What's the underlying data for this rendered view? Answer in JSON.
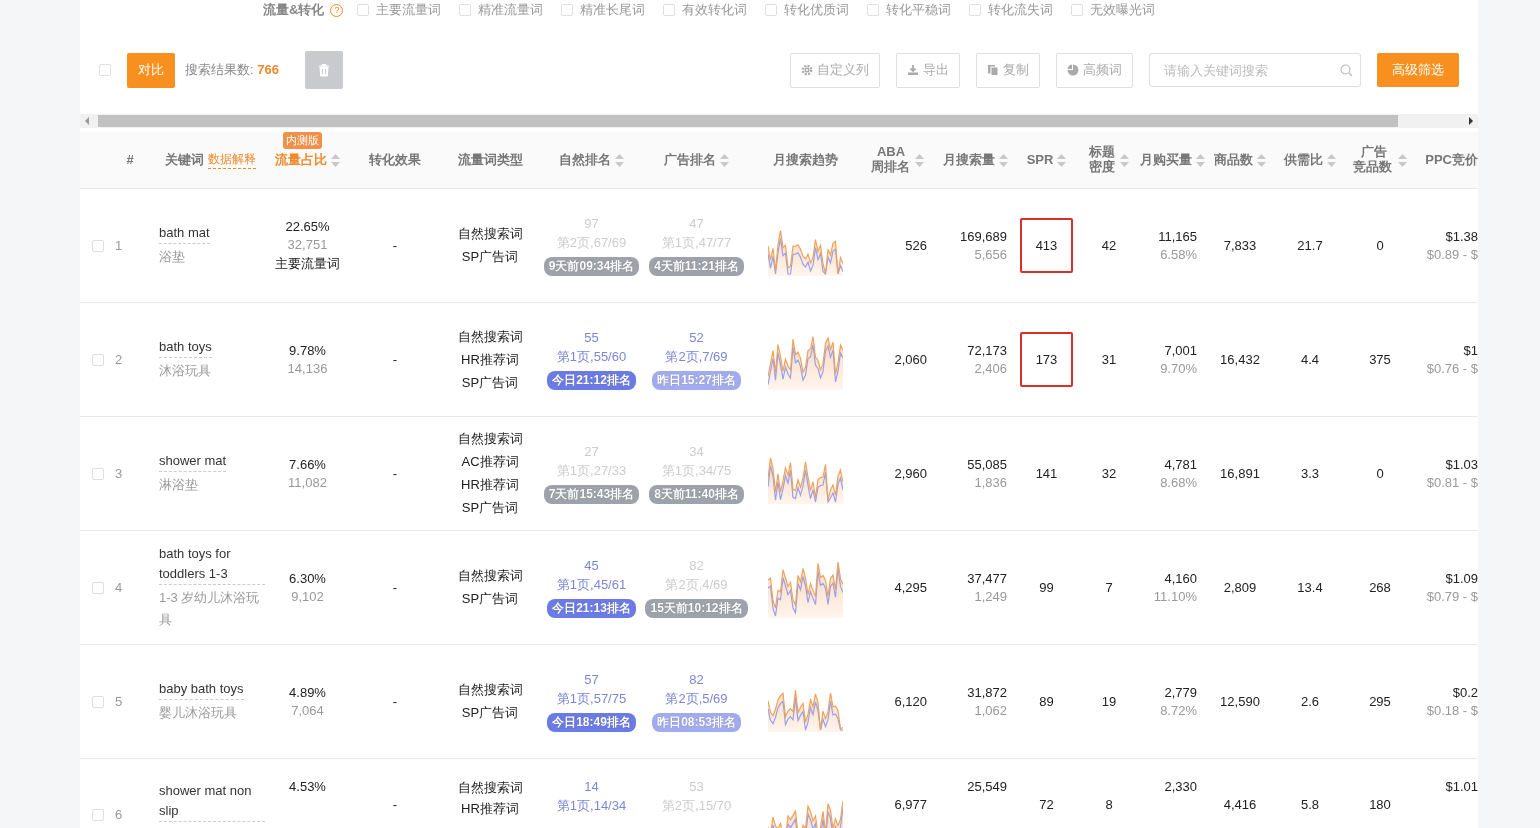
{
  "filters": {
    "label": "流量&转化",
    "help": "?",
    "options": [
      {
        "label": "主要流量词",
        "checked": false
      },
      {
        "label": "精准流量词",
        "checked": false
      },
      {
        "label": "精准长尾词",
        "checked": false
      },
      {
        "label": "有效转化词",
        "checked": false
      },
      {
        "label": "转化优质词",
        "checked": false
      },
      {
        "label": "转化平稳词",
        "checked": false
      },
      {
        "label": "转化流失词",
        "checked": false
      },
      {
        "label": "无效曝光词",
        "checked": false
      }
    ]
  },
  "toolbar": {
    "select_all": {
      "checked": false
    },
    "compare_button": "对比",
    "result_label": "搜索结果数: ",
    "result_count": "766",
    "delete_disabled": true,
    "buttons": [
      {
        "kind": "gear",
        "label": "自定义列"
      },
      {
        "kind": "download",
        "label": "导出"
      },
      {
        "kind": "copy",
        "label": "复制"
      },
      {
        "kind": "pie",
        "label": "高频词"
      }
    ],
    "search": {
      "placeholder": "请输入关键词搜索"
    },
    "filter_button": "高级筛选"
  },
  "table": {
    "columns": [
      {
        "label": "#",
        "sortable": false
      },
      {
        "label": "关键词",
        "sortable": false,
        "link": "数据解释"
      },
      {
        "label": "流量占比",
        "sortable": true,
        "badge": "内测版"
      },
      {
        "label": "转化效果",
        "sortable": false
      },
      {
        "label": "流量词类型",
        "sortable": false
      },
      {
        "label": "自然排名",
        "sortable": true
      },
      {
        "label": "广告排名",
        "sortable": true
      },
      {
        "label": "月搜索趋势",
        "sortable": false
      },
      {
        "label": "ABA周排名",
        "sortable": true
      },
      {
        "label": "月搜索量",
        "sortable": true
      },
      {
        "label": "SPR",
        "sortable": true
      },
      {
        "label": "标题密度",
        "sortable": true
      },
      {
        "label": "月购买量",
        "sortable": true
      },
      {
        "label": "商品数",
        "sortable": true
      },
      {
        "label": "供需比",
        "sortable": true
      },
      {
        "label": "广告竞品数",
        "sortable": true
      },
      {
        "label": "PPC竞价",
        "sortable": false
      }
    ],
    "rows": [
      {
        "checked": false,
        "index": "1",
        "keyword": "bath mat",
        "translation": "浴垫",
        "share": "22.65%",
        "share_count": "32,751",
        "tag": "主要流量词",
        "conversion": "-",
        "types": [
          "自然搜索词",
          "SP广告词"
        ],
        "natural": {
          "rank": "97",
          "page": "第2页,67/69",
          "badge": "9天前09:34排名",
          "fresh": false,
          "color": "#9ea2aa"
        },
        "ad": {
          "rank": "47",
          "page": "第1页,47/77",
          "badge": "4天前11:21排名",
          "fresh": false,
          "color": "#9ea2aa"
        },
        "aba": "526",
        "searches": "169,689",
        "searches_sub": "5,656",
        "spr": "413",
        "spr_highlighted": true,
        "density": "42",
        "purchases": "11,165",
        "purchase_rate": "6.58%",
        "products": "7,833",
        "ratio": "21.7",
        "ad_count": "0",
        "ppc": "$1.38",
        "ppc_range": "$0.89 - $"
      },
      {
        "checked": false,
        "index": "2",
        "keyword": "bath toys",
        "translation": "沐浴玩具",
        "share": "9.78%",
        "share_count": "14,136",
        "conversion": "-",
        "types": [
          "自然搜索词",
          "HR推荐词",
          "SP广告词"
        ],
        "natural": {
          "rank": "55",
          "page": "第1页,55/60",
          "badge": "今日21:12排名",
          "fresh": true,
          "color": "#6b7be6"
        },
        "ad": {
          "rank": "52",
          "page": "第2页,7/69",
          "badge": "昨日15:27排名",
          "fresh": true,
          "color": "#a2abee"
        },
        "aba": "2,060",
        "searches": "72,173",
        "searches_sub": "2,406",
        "spr": "173",
        "spr_highlighted": true,
        "density": "31",
        "purchases": "7,001",
        "purchase_rate": "9.70%",
        "products": "16,432",
        "ratio": "4.4",
        "ad_count": "375",
        "ppc": "$1",
        "ppc_range": "$0.76 - $"
      },
      {
        "checked": false,
        "index": "3",
        "keyword": "shower mat",
        "translation": "淋浴垫",
        "share": "7.66%",
        "share_count": "11,082",
        "conversion": "-",
        "types": [
          "自然搜索词",
          "AC推荐词",
          "HR推荐词",
          "SP广告词"
        ],
        "natural": {
          "rank": "27",
          "page": "第1页,27/33",
          "badge": "7天前15:43排名",
          "fresh": false,
          "color": "#9ea2aa"
        },
        "ad": {
          "rank": "34",
          "page": "第1页,34/75",
          "badge": "8天前11:40排名",
          "fresh": false,
          "color": "#9ea2aa"
        },
        "aba": "2,960",
        "searches": "55,085",
        "searches_sub": "1,836",
        "spr": "141",
        "spr_highlighted": false,
        "density": "32",
        "purchases": "4,781",
        "purchase_rate": "8.68%",
        "products": "16,891",
        "ratio": "3.3",
        "ad_count": "0",
        "ppc": "$1.03",
        "ppc_range": "$0.81 - $"
      },
      {
        "checked": false,
        "index": "4",
        "keyword": "bath toys for toddlers 1-3",
        "translation": "1-3 岁幼儿沐浴玩具",
        "share": "6.30%",
        "share_count": "9,102",
        "conversion": "-",
        "types": [
          "自然搜索词",
          "SP广告词"
        ],
        "natural": {
          "rank": "45",
          "page": "第1页,45/61",
          "badge": "今日21:13排名",
          "fresh": true,
          "color": "#6b7be6"
        },
        "ad": {
          "rank": "82",
          "page": "第2页,4/69",
          "badge": "15天前10:12排名",
          "fresh": false,
          "color": "#9ea2aa"
        },
        "aba": "4,295",
        "searches": "37,477",
        "searches_sub": "1,249",
        "spr": "99",
        "spr_highlighted": false,
        "density": "7",
        "purchases": "4,160",
        "purchase_rate": "11.10%",
        "products": "2,809",
        "ratio": "13.4",
        "ad_count": "268",
        "ppc": "$1.09",
        "ppc_range": "$0.79 - $"
      },
      {
        "checked": false,
        "index": "5",
        "keyword": "baby bath toys",
        "translation": "婴儿沐浴玩具",
        "share": "4.89%",
        "share_count": "7,064",
        "conversion": "-",
        "types": [
          "自然搜索词",
          "SP广告词"
        ],
        "natural": {
          "rank": "57",
          "page": "第1页,57/75",
          "badge": "今日18:49排名",
          "fresh": true,
          "color": "#6b7be6"
        },
        "ad": {
          "rank": "82",
          "page": "第2页,5/69",
          "badge": "昨日08:53排名",
          "fresh": true,
          "color": "#a2abee"
        },
        "aba": "6,120",
        "searches": "31,872",
        "searches_sub": "1,062",
        "spr": "89",
        "spr_highlighted": false,
        "density": "19",
        "purchases": "2,779",
        "purchase_rate": "8.72%",
        "products": "12,590",
        "ratio": "2.6",
        "ad_count": "295",
        "ppc": "$0.2",
        "ppc_range": "$0.18 - $"
      },
      {
        "checked": false,
        "index": "6",
        "keyword": "shower mat non slip",
        "share": "4.53%",
        "conversion": "-",
        "types": [
          "自然搜索词",
          "HR推荐词"
        ],
        "natural": {
          "rank": "14",
          "page": "第1页,14/34",
          "fresh": true
        },
        "ad": {
          "rank": "53",
          "page": "第2页,15/70",
          "fresh": false
        },
        "aba": "6,977",
        "searches": "25,549",
        "spr": "72",
        "spr_highlighted": false,
        "density": "8",
        "purchases": "2,330",
        "products": "4,416",
        "ratio": "5.8",
        "ad_count": "180",
        "ppc": "$1.01"
      }
    ]
  }
}
